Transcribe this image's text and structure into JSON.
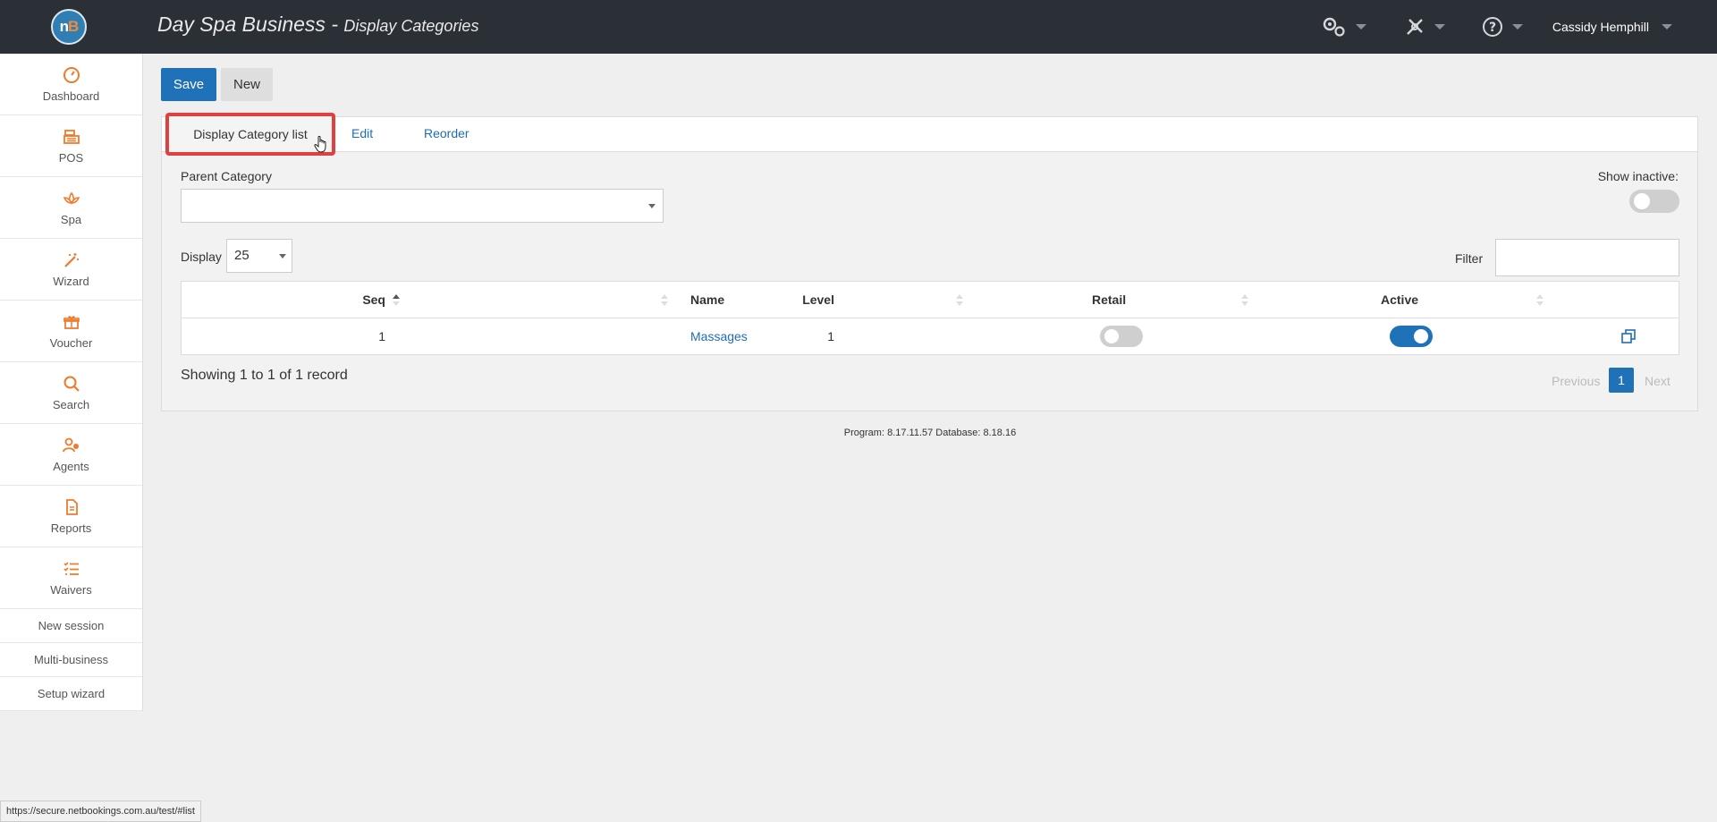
{
  "header": {
    "logo_text_n": "n",
    "logo_text_b": "B",
    "title": "Day Spa Business -",
    "subtitle": "Display Categories",
    "user_name": "Cassidy Hemphill"
  },
  "sidebar": {
    "items": [
      {
        "label": "Dashboard",
        "icon": "dashboard-icon"
      },
      {
        "label": "POS",
        "icon": "register-icon"
      },
      {
        "label": "Spa",
        "icon": "lotus-icon"
      },
      {
        "label": "Wizard",
        "icon": "magic-wand-icon"
      },
      {
        "label": "Voucher",
        "icon": "gift-icon"
      },
      {
        "label": "Search",
        "icon": "search-icon"
      },
      {
        "label": "Agents",
        "icon": "agents-icon"
      },
      {
        "label": "Reports",
        "icon": "document-icon"
      },
      {
        "label": "Waivers",
        "icon": "checklist-icon"
      }
    ],
    "links": [
      "New session",
      "Multi-business",
      "Setup wizard"
    ]
  },
  "toolbar": {
    "save_label": "Save",
    "new_label": "New"
  },
  "tabs": [
    {
      "label": "Display Category list",
      "active": true
    },
    {
      "label": "Edit",
      "active": false
    },
    {
      "label": "Reorder",
      "active": false
    }
  ],
  "filters": {
    "parent_category_label": "Parent Category",
    "parent_category_value": "",
    "show_inactive_label": "Show inactive:",
    "show_inactive": false,
    "display_label": "Display",
    "display_value": "25",
    "filter_label": "Filter",
    "filter_value": ""
  },
  "table": {
    "columns": [
      "Seq",
      "Level",
      "Name",
      "Retail",
      "Active"
    ],
    "rows": [
      {
        "seq": "1",
        "level": "1",
        "name": "Massages",
        "retail": false,
        "active": true
      }
    ]
  },
  "pagination": {
    "showing": "Showing 1 to 1 of 1 record",
    "previous": "Previous",
    "current": "1",
    "next": "Next"
  },
  "footer": {
    "version": "Program: 8.17.11.57 Database: 8.18.16"
  },
  "statusbar": {
    "url": "https://secure.netbookings.com.au/test/#list"
  },
  "colors": {
    "accent": "#1f72b8",
    "header_bg": "#2b2f36",
    "icon_orange": "#f07a2a",
    "highlight": "#e04040"
  }
}
